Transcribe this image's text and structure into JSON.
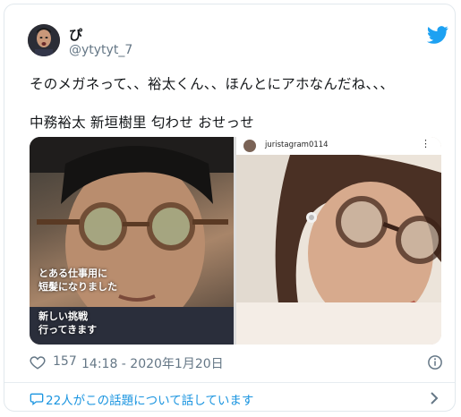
{
  "tweet": {
    "author": {
      "display_name": "ぴ",
      "handle": "@ytytyt_7"
    },
    "text_line1": "そのメガネって、、裕太くん、、ほんとにアホなんだね、、、",
    "text_line2": "中務裕太 新垣樹里 匂わせ おせっせ",
    "media": {
      "left_caption_1": "とある仕事用に\n短髪になりました",
      "left_caption_2": "新しい挑戦\n行ってきます",
      "right_ig_user": "juristagram0114"
    },
    "likes": "157",
    "timestamp": "14:18 - 2020年1月20日",
    "conversation": "22人がこの話題について話しています"
  },
  "colors": {
    "accent": "#1da1f2",
    "link": "#1b95e0",
    "muted": "#657786",
    "border": "#e1e8ed"
  },
  "icons": [
    "twitter-bird-icon",
    "heart-icon",
    "info-icon",
    "speech-bubble-icon",
    "chevron-right-icon",
    "more-icon"
  ]
}
